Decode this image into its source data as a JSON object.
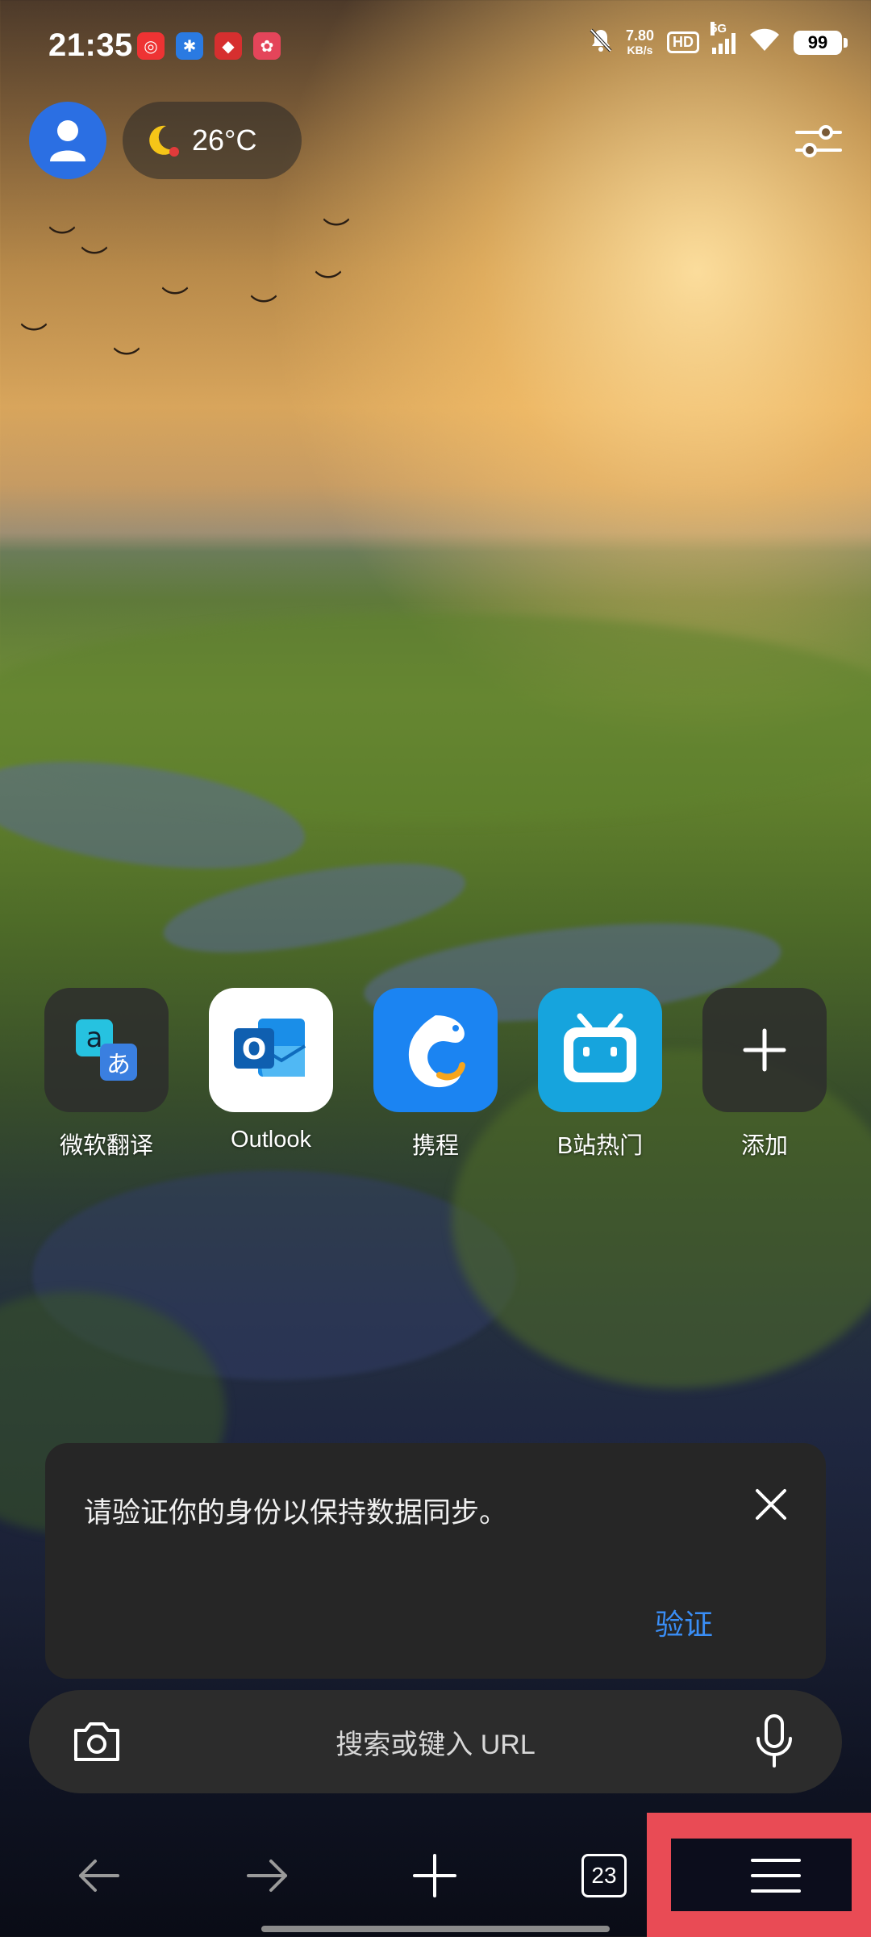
{
  "status_bar": {
    "time": "21:35",
    "net_speed_value": "7.80",
    "net_speed_unit": "KB/s",
    "hd_label": "HD",
    "network_type": "5G",
    "battery": "99"
  },
  "weather": {
    "temperature": "26°C",
    "icon": "moon-icon"
  },
  "speed_dial": [
    {
      "label": "微软翻译",
      "icon": "microsoft-translator-icon"
    },
    {
      "label": "Outlook",
      "icon": "outlook-icon"
    },
    {
      "label": "携程",
      "icon": "ctrip-icon"
    },
    {
      "label": "B站热门",
      "icon": "bilibili-icon"
    },
    {
      "label": "添加",
      "icon": "plus-icon"
    }
  ],
  "verify_card": {
    "message": "请验证你的身份以保持数据同步。",
    "action_label": "验证"
  },
  "search": {
    "placeholder": "搜索或键入 URL"
  },
  "toolbar": {
    "tab_count": "23"
  },
  "colors": {
    "accent": "#3a8ef6",
    "highlight": "#e94b55",
    "avatar_bg": "#2b6fe3"
  }
}
